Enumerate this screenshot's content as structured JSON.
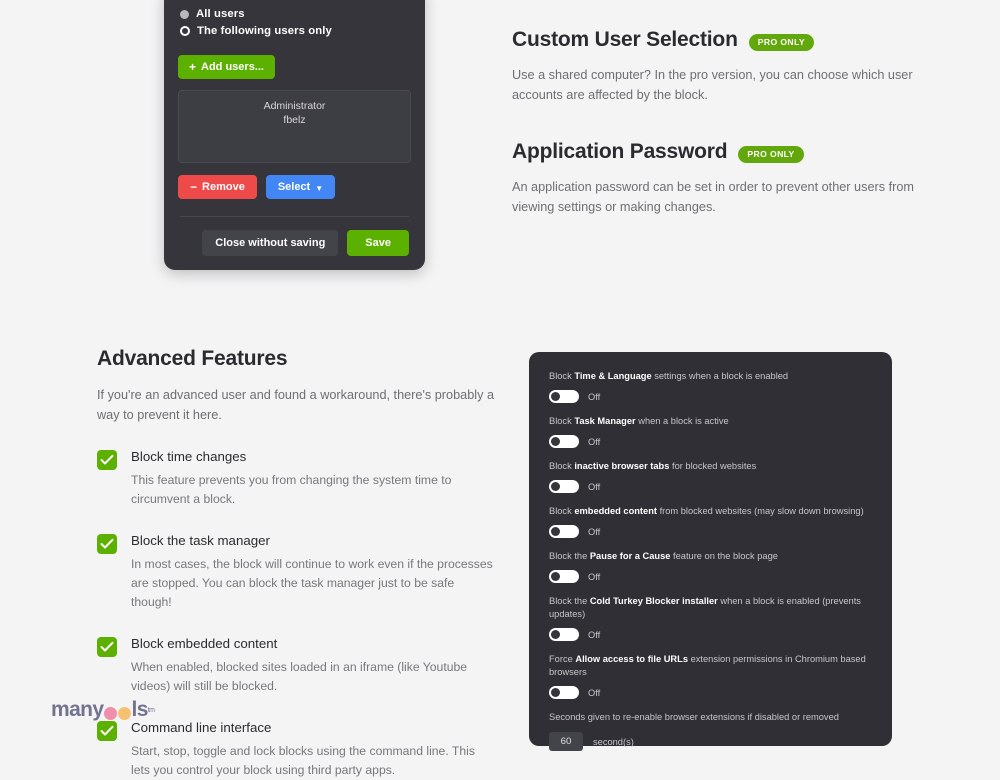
{
  "modal": {
    "radios": [
      {
        "label": "All users",
        "selected": false
      },
      {
        "label": "The following users only",
        "selected": true
      }
    ],
    "add_users_label": "Add users...",
    "user_list": [
      "Administrator",
      "fbelz"
    ],
    "remove_label": "Remove",
    "select_label": "Select",
    "close_label": "Close without saving",
    "save_label": "Save"
  },
  "pro_sections": [
    {
      "heading": "Custom User Selection",
      "badge": "PRO ONLY",
      "body": "Use a shared computer? In the pro version, you can choose which user accounts are affected by the block."
    },
    {
      "heading": "Application Password",
      "badge": "PRO ONLY",
      "body": "An application password can be set in order to prevent other users from viewing settings or making changes."
    }
  ],
  "advanced": {
    "title": "Advanced Features",
    "intro": "If you're an advanced user and found a workaround, there's probably a way to prevent it here.",
    "features": [
      {
        "title": "Block time changes",
        "desc": "This feature prevents you from changing the system time to circumvent a block.",
        "checked": true
      },
      {
        "title": "Block the task manager",
        "desc": "In most cases, the block will continue to work even if the processes are stopped. You can block the task manager just to be safe though!",
        "checked": true
      },
      {
        "title": "Block embedded content",
        "desc": "When enabled, blocked sites loaded in an iframe (like Youtube videos) will still be blocked.",
        "checked": true
      },
      {
        "title": "Command line interface",
        "desc": "Start, stop, toggle and lock blocks using the command line. This lets you control your block using third party apps.",
        "checked": true
      }
    ]
  },
  "panel": {
    "settings": [
      {
        "pre": "Block ",
        "bold": "Time & Language",
        "post": " settings when a block is enabled",
        "state": "Off"
      },
      {
        "pre": "Block ",
        "bold": "Task Manager",
        "post": " when a block is active",
        "state": "Off"
      },
      {
        "pre": "Block ",
        "bold": "inactive browser tabs",
        "post": " for blocked websites",
        "state": "Off"
      },
      {
        "pre": "Block ",
        "bold": "embedded content",
        "post": " from blocked websites (may slow down browsing)",
        "state": "Off"
      },
      {
        "pre": "Block the ",
        "bold": "Pause for a Cause",
        "post": " feature on the block page",
        "state": "Off"
      },
      {
        "pre": "Block the ",
        "bold": "Cold Turkey Blocker installer",
        "post": " when a block is enabled (prevents updates)",
        "state": "Off"
      },
      {
        "pre": "Force ",
        "bold": "Allow access to file URLs",
        "post": " extension permissions in Chromium based browsers",
        "state": "Off"
      }
    ],
    "seconds_label": "Seconds given to re-enable browser extensions if disabled or removed",
    "seconds_value": "60",
    "seconds_unit": "second(s)"
  },
  "watermark": {
    "part1": "many",
    "part2": "ls",
    "tm": "tm"
  },
  "colors": {
    "page_bg": "#f4f4f5",
    "modal_bg": "#35353b",
    "panel_bg": "#2f2f35",
    "green": "#5cb100",
    "badge_green": "#62a80c",
    "red": "#ef4a4a",
    "blue": "#4387f4"
  }
}
